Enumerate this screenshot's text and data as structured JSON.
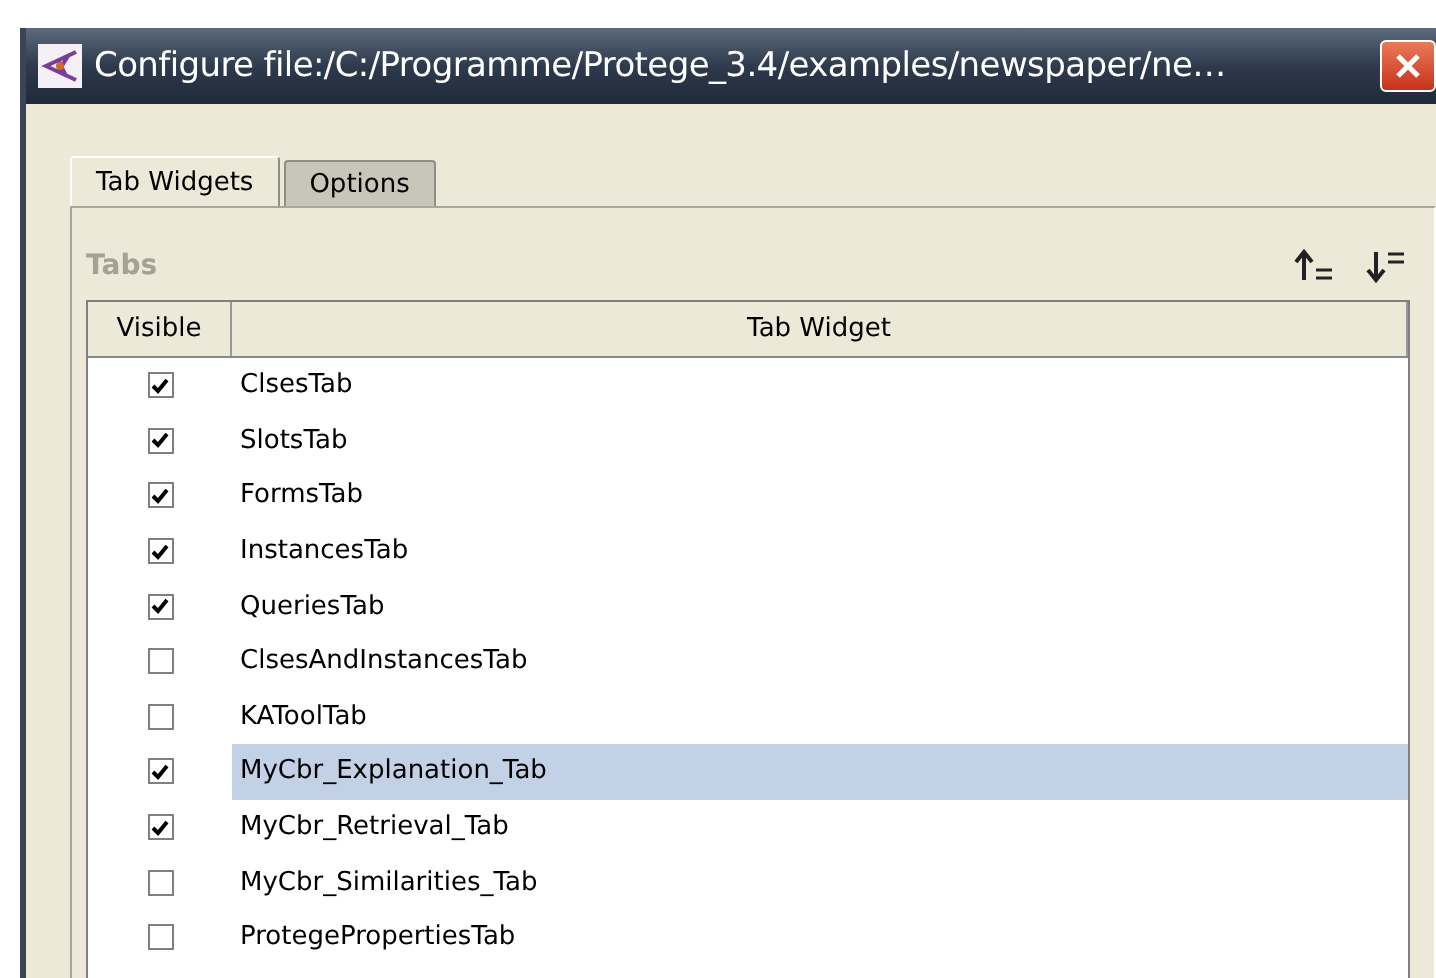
{
  "window": {
    "title": "Configure file:/C:/Programme/Protege_3.4/examples/newspaper/ne…"
  },
  "tabs": [
    {
      "label": "Tab Widgets",
      "selected": true
    },
    {
      "label": "Options",
      "selected": false
    }
  ],
  "section": {
    "title": "Tabs"
  },
  "table": {
    "columns": [
      "Visible",
      "Tab Widget"
    ],
    "rows": [
      {
        "name": "ClsesTab",
        "visible": true,
        "selected": false
      },
      {
        "name": "SlotsTab",
        "visible": true,
        "selected": false
      },
      {
        "name": "FormsTab",
        "visible": true,
        "selected": false
      },
      {
        "name": "InstancesTab",
        "visible": true,
        "selected": false
      },
      {
        "name": "QueriesTab",
        "visible": true,
        "selected": false
      },
      {
        "name": "ClsesAndInstancesTab",
        "visible": false,
        "selected": false
      },
      {
        "name": "KAToolTab",
        "visible": false,
        "selected": false
      },
      {
        "name": "MyCbr_Explanation_Tab",
        "visible": true,
        "selected": true
      },
      {
        "name": "MyCbr_Retrieval_Tab",
        "visible": true,
        "selected": false
      },
      {
        "name": "MyCbr_Similarities_Tab",
        "visible": false,
        "selected": false
      },
      {
        "name": "ProtegePropertiesTab",
        "visible": false,
        "selected": false
      }
    ]
  }
}
